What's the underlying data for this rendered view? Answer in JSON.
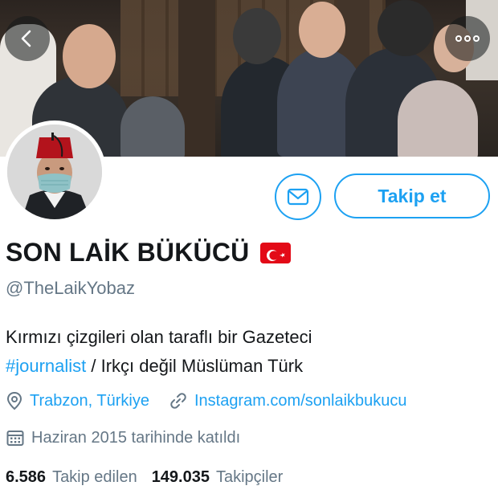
{
  "header": {
    "back_icon": "chevron-left-icon",
    "more_icon": "more-horizontal-icon"
  },
  "profile": {
    "display_name": "SON LAİK BÜKÜCÜ",
    "flag": "turkish-flag-emoji",
    "handle": "@TheLaikYobaz",
    "bio_line1": "Kırmızı çizgileri olan taraflı bir Gazeteci",
    "bio_hashtag": "#journalist",
    "bio_line2_rest": " / Irkçı değil Müslüman Türk",
    "location": "Trabzon, Türkiye",
    "website": "Instagram.com/sonlaikbukucu",
    "joined": "Haziran 2015 tarihinde katıldı"
  },
  "actions": {
    "message_icon": "envelope-icon",
    "follow_label": "Takip et"
  },
  "stats": {
    "following_count": "6.586",
    "following_label": "Takip edilen",
    "followers_count": "149.035",
    "followers_label": "Takipçiler"
  },
  "colors": {
    "accent": "#1da1f2",
    "text_primary": "#14171a",
    "text_secondary": "#657786",
    "flag_red": "#e30a17"
  }
}
